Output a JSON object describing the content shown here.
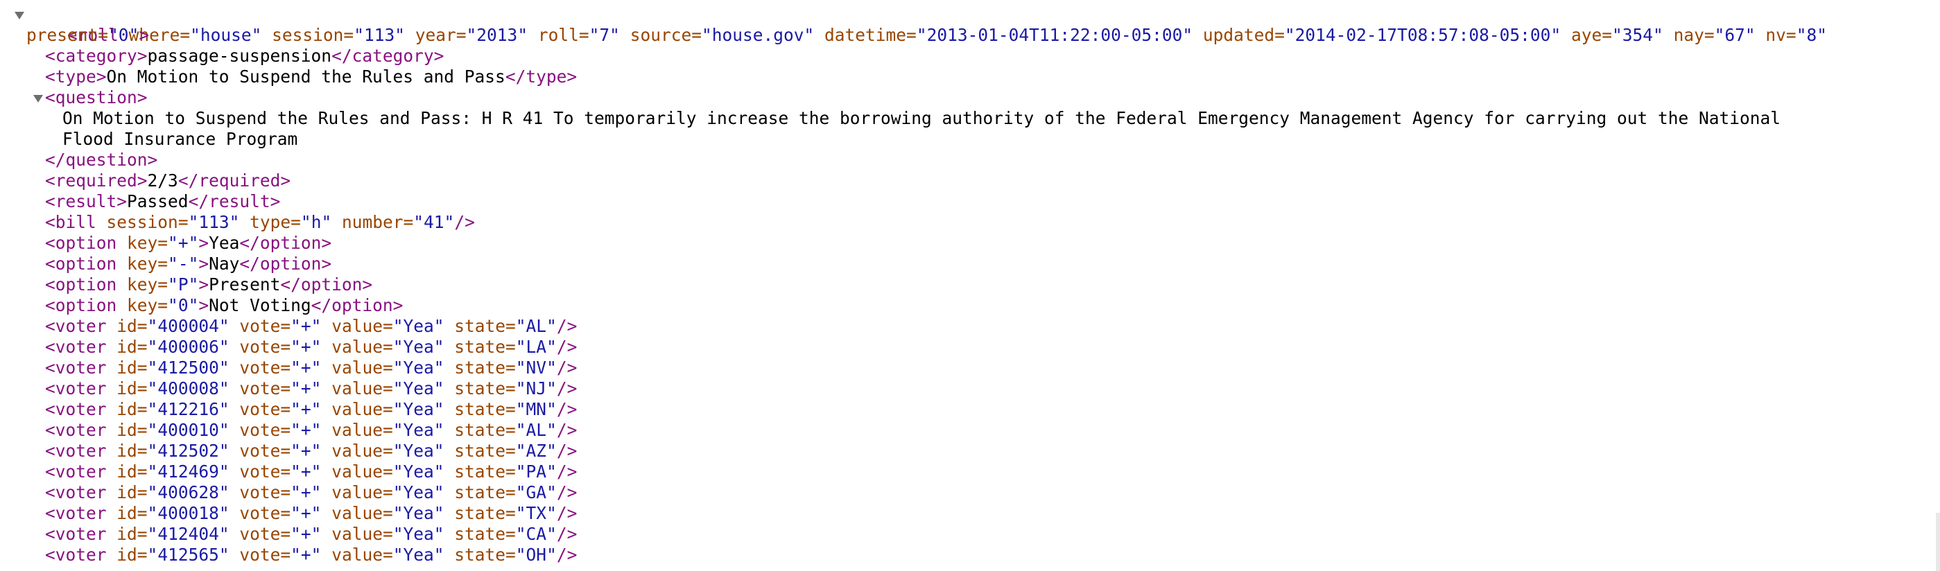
{
  "roll": {
    "tag": "roll",
    "attrs": [
      {
        "name": "where",
        "value": "house"
      },
      {
        "name": "session",
        "value": "113"
      },
      {
        "name": "year",
        "value": "2013"
      },
      {
        "name": "roll",
        "value": "7"
      },
      {
        "name": "source",
        "value": "house.gov"
      },
      {
        "name": "datetime",
        "value": "2013-01-04T11:22:00-05:00"
      },
      {
        "name": "updated",
        "value": "2014-02-17T08:57:08-05:00"
      },
      {
        "name": "aye",
        "value": "354"
      },
      {
        "name": "nay",
        "value": "67"
      },
      {
        "name": "nv",
        "value": "8"
      },
      {
        "name": "present",
        "value": "0"
      }
    ]
  },
  "category": {
    "tag": "category",
    "text": "passage-suspension"
  },
  "type": {
    "tag": "type",
    "text": "On Motion to Suspend the Rules and Pass"
  },
  "question": {
    "tag": "question",
    "line1": "On Motion to Suspend the Rules and Pass: H R 41 To temporarily increase the borrowing authority of the Federal Emergency Management Agency for carrying out the National",
    "line2": "Flood Insurance Program"
  },
  "required": {
    "tag": "required",
    "text": "2/3"
  },
  "result": {
    "tag": "result",
    "text": "Passed"
  },
  "bill": {
    "tag": "bill",
    "attrs": [
      {
        "name": "session",
        "value": "113"
      },
      {
        "name": "type",
        "value": "h"
      },
      {
        "name": "number",
        "value": "41"
      }
    ]
  },
  "options": [
    {
      "key": "+",
      "text": "Yea"
    },
    {
      "key": "-",
      "text": "Nay"
    },
    {
      "key": "P",
      "text": "Present"
    },
    {
      "key": "0",
      "text": "Not Voting"
    }
  ],
  "voters": [
    {
      "id": "400004",
      "vote": "+",
      "value": "Yea",
      "state": "AL"
    },
    {
      "id": "400006",
      "vote": "+",
      "value": "Yea",
      "state": "LA"
    },
    {
      "id": "412500",
      "vote": "+",
      "value": "Yea",
      "state": "NV"
    },
    {
      "id": "400008",
      "vote": "+",
      "value": "Yea",
      "state": "NJ"
    },
    {
      "id": "412216",
      "vote": "+",
      "value": "Yea",
      "state": "MN"
    },
    {
      "id": "400010",
      "vote": "+",
      "value": "Yea",
      "state": "AL"
    },
    {
      "id": "412502",
      "vote": "+",
      "value": "Yea",
      "state": "AZ"
    },
    {
      "id": "412469",
      "vote": "+",
      "value": "Yea",
      "state": "PA"
    },
    {
      "id": "400628",
      "vote": "+",
      "value": "Yea",
      "state": "GA"
    },
    {
      "id": "400018",
      "vote": "+",
      "value": "Yea",
      "state": "TX"
    },
    {
      "id": "412404",
      "vote": "+",
      "value": "Yea",
      "state": "CA"
    },
    {
      "id": "412565",
      "vote": "+",
      "value": "Yea",
      "state": "OH"
    }
  ],
  "colors": {
    "tag": "#881280",
    "attribute": "#994500",
    "value": "#1a1aa6",
    "text": "#000000",
    "toggle": "#6e6e6e"
  },
  "icons": {
    "toggle": "disclosure-triangle-down-icon"
  }
}
